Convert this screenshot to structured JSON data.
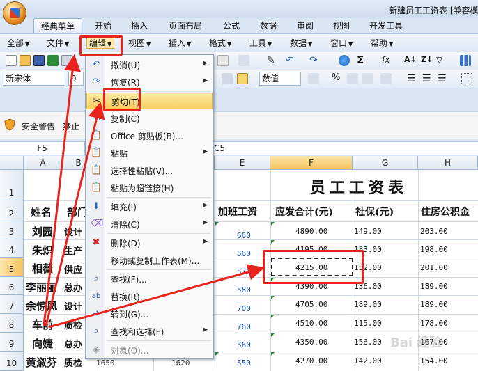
{
  "window": {
    "title": "新建员工工资表 [兼容模"
  },
  "ribbon_tabs": [
    "经典菜单",
    "开始",
    "插入",
    "页面布局",
    "公式",
    "数据",
    "审阅",
    "视图",
    "开发工具"
  ],
  "menubar": [
    "全部",
    "文件",
    "编辑",
    "视图",
    "插入",
    "格式",
    "工具",
    "数据",
    "窗口",
    "帮助"
  ],
  "toolbar": {
    "font_name": "新宋体",
    "font_size": "9",
    "number_format": "数值",
    "percent": "%"
  },
  "security": {
    "label": "安全警告",
    "disable": "禁止"
  },
  "formula_bar": {
    "name_box": "F5",
    "content": "C5"
  },
  "columns": [
    "A",
    "B",
    "C",
    "D",
    "E",
    "F",
    "G",
    "H"
  ],
  "rows": [
    "1",
    "2",
    "3",
    "4",
    "5",
    "6",
    "7",
    "8",
    "9",
    "10"
  ],
  "sheet": {
    "title": "员工工资表",
    "headers": {
      "a": "姓名",
      "b": "部门",
      "e": "加班工资",
      "f": "应发合计(元)",
      "g": "社保(元)",
      "h": "住房公积金"
    },
    "names": [
      "刘园",
      "朱炽",
      "相薇",
      "李丽丽",
      "余惊凤",
      "车前",
      "向婕",
      "黄溆芬"
    ],
    "depts": [
      "设计",
      "生产",
      "供应",
      "总办",
      "设计",
      "质检",
      "总办",
      "质检"
    ],
    "overtime": [
      "660",
      "560",
      "570",
      "580",
      "700",
      "760",
      "560",
      "550"
    ],
    "gross": [
      "4890.00",
      "4195.00",
      "4215.00",
      "4390.00",
      "4705.00",
      "4510.00",
      "4350.00",
      "4270.00"
    ],
    "social": [
      "149.00",
      "183.00",
      "152.00",
      "136.00",
      "189.00",
      "115.00",
      "156.00",
      "142.00"
    ],
    "housing": [
      "203.00",
      "198.00",
      "201.00",
      "189.00",
      "189.00",
      "178.00",
      "167.00",
      "154.00"
    ],
    "c10": "1650",
    "d10": "1620"
  },
  "edit_menu": {
    "undo": "撤消(U)",
    "redo": "恢复(R)",
    "cut": "剪切(T)",
    "copy": "复制(C)",
    "clipboard": "Office 剪贴板(B)...",
    "paste": "粘贴",
    "paste_special": "选择性粘贴(V)...",
    "paste_link": "粘贴为超链接(H)",
    "fill": "填充(I)",
    "clear": "清除(C)",
    "delete": "删除(D)",
    "move_copy": "移动或复制工作表(M)...",
    "find": "查找(F)...",
    "replace": "替换(R)...",
    "goto": "转到(G)...",
    "find_select": "查找和选择(F)",
    "object": "对象(O)..."
  },
  "watermark": "Bai 经验"
}
